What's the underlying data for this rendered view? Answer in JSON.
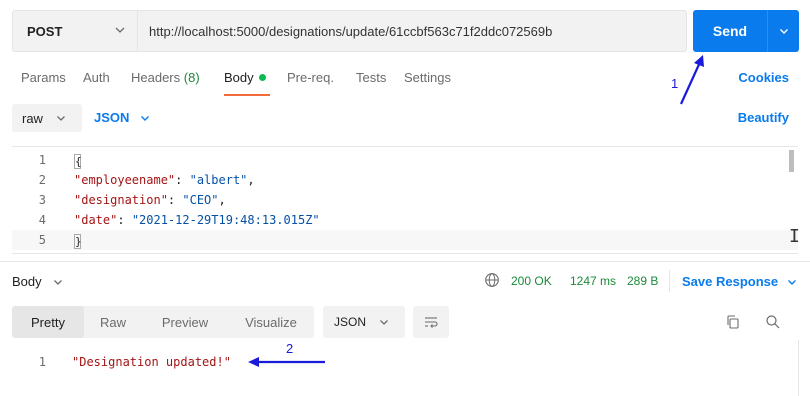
{
  "request": {
    "method": "POST",
    "url": "http://localhost:5000/designations/update/61ccbf563c71f2ddc072569b",
    "send_label": "Send"
  },
  "tabs": [
    {
      "label": "Params"
    },
    {
      "label": "Auth"
    },
    {
      "label": "Headers",
      "count": "(8)"
    },
    {
      "label": "Body"
    },
    {
      "label": "Pre-req."
    },
    {
      "label": "Tests"
    },
    {
      "label": "Settings"
    }
  ],
  "cookies_label": "Cookies",
  "body_options": {
    "mode": "raw",
    "language": "JSON",
    "beautify_label": "Beautify"
  },
  "editor": {
    "line_numbers": [
      "1",
      "2",
      "3",
      "4",
      "5"
    ],
    "open_brace": "{",
    "close_brace": "}",
    "fields": [
      {
        "key": "\"employeename\"",
        "value": "\"albert\""
      },
      {
        "key": "\"designation\"",
        "value": "\"CEO\""
      },
      {
        "key": "\"date\"",
        "value": "\"2021-12-29T19:48:13.015Z\""
      }
    ]
  },
  "response": {
    "tab_label": "Body",
    "status": "200 OK",
    "time": "1247 ms",
    "size": "289 B",
    "save_label": "Save Response",
    "view_tabs": [
      "Pretty",
      "Raw",
      "Preview",
      "Visualize"
    ],
    "format": "JSON",
    "line_number": "1",
    "body": "\"Designation updated!\""
  },
  "annotations": {
    "one": "1",
    "two": "2"
  },
  "colors": {
    "accent": "#097bed",
    "success": "#1c8a3b",
    "active_tab_underline": "#f26b3a",
    "annotation": "#1a1adb"
  },
  "icons": [
    "chevron-down-icon",
    "globe-icon",
    "copy-icon",
    "search-icon",
    "wrap-lines-icon"
  ]
}
